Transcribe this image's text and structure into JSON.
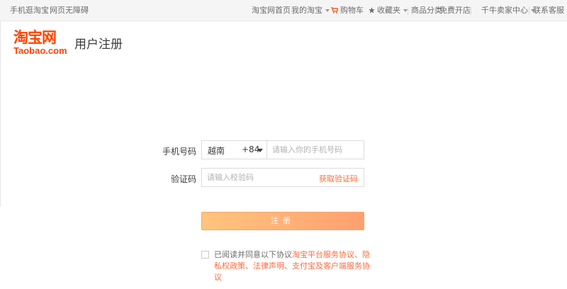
{
  "topbar": {
    "left": [
      "手机逛淘宝",
      "网页无障碍"
    ],
    "right": {
      "home": "淘宝网首页",
      "my_taobao": "我的淘宝",
      "cart": "购物车",
      "favorites": "收藏夹",
      "categories": "商品分类",
      "open_shop": "免费开店",
      "seller_center": "千牛卖家中心",
      "support": "联系客服"
    }
  },
  "logo": {
    "cn": "淘宝网",
    "en": "Taobao.com"
  },
  "page_title": "用户注册",
  "form": {
    "phone_label": "手机号码",
    "country_name": "越南",
    "country_code": "+84",
    "phone_placeholder": "请输入你的手机号码",
    "code_label": "验证码",
    "code_placeholder": "请输入校验码",
    "get_code": "获取验证码",
    "submit": "注册"
  },
  "agreement": {
    "prefix": "已阅读并同意以下协议",
    "links": [
      "淘宝平台服务协议",
      "隐私权政策",
      "法律声明",
      "支付宝及客户端服务协议"
    ],
    "separator": "、"
  },
  "colors": {
    "accent": "#ff4400",
    "link": "#ff6a3c",
    "button_start": "#ffc57d",
    "button_end": "#ff9f71"
  },
  "icons": {
    "cart": "cart-icon",
    "favorites": "star-icon"
  }
}
